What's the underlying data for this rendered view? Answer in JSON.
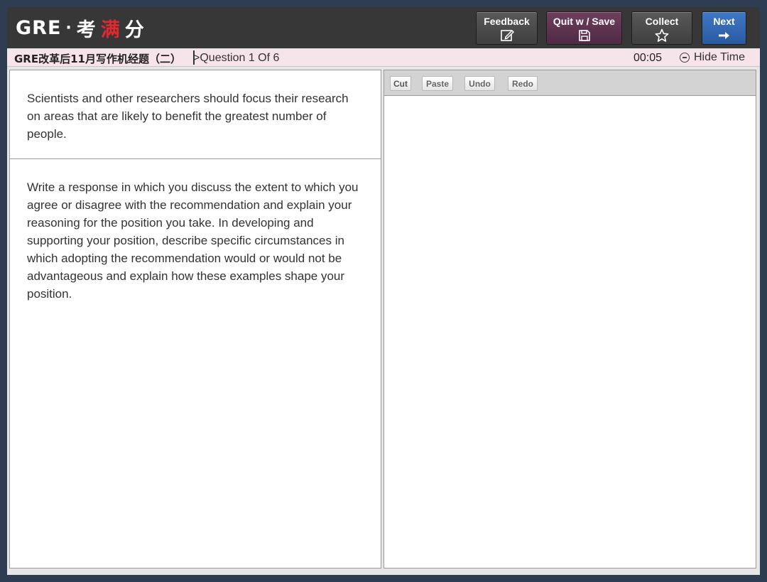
{
  "header": {
    "logo_gre": "GRE",
    "logo_dot": "·",
    "logo_cn_a": "考",
    "logo_cn_b": "满",
    "logo_cn_c": "分",
    "buttons": {
      "feedback": "Feedback",
      "quit_save": "Quit w / Save",
      "collect": "Collect",
      "next": "Next"
    },
    "icons": {
      "feedback": "edit-icon",
      "quit_save": "save-icon",
      "collect": "star-icon",
      "next": "arrow-right-icon"
    },
    "colors": {
      "bar": "#373737",
      "quit_save": "#5e3550",
      "next": "#3468b4"
    }
  },
  "info_bar": {
    "title": "GRE改革后11月写作机经题（二）",
    "question_label": ">Question 1 Of 6",
    "timer": "00:05",
    "hide_time": "Hide Time",
    "background": "#f6e4ea"
  },
  "left_pane": {
    "prompt": "Scientists and other researchers should focus their research on areas that are likely to benefit the greatest number of people.",
    "instructions": "Write a response in which you discuss the extent to which you agree or disagree with the recommendation and explain your reasoning for the position you take. In developing and supporting your position, describe specific circumstances in which adopting the recommendation would or would not be advantageous and explain how these examples shape your position."
  },
  "editor": {
    "toolbar": {
      "cut": "Cut",
      "paste": "Paste",
      "undo": "Undo",
      "redo": "Redo"
    },
    "text": ""
  }
}
